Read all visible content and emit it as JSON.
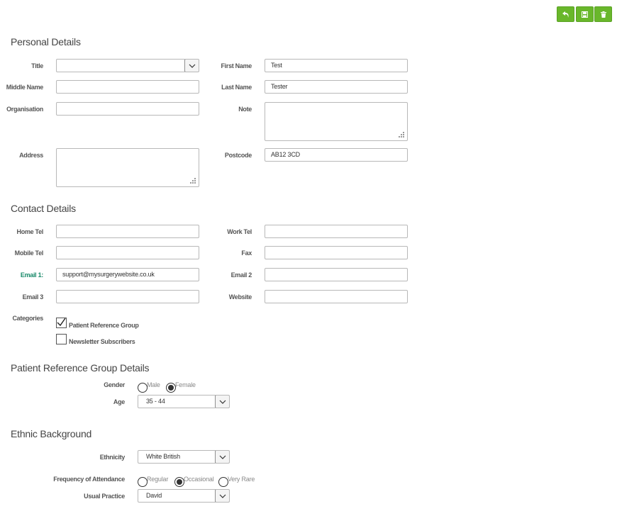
{
  "toolbar": {
    "back_icon": "undo-icon",
    "save_icon": "save-icon",
    "delete_icon": "trash-icon",
    "accent": "#69b72b"
  },
  "personal": {
    "title": "Personal Details",
    "title_label": "Title",
    "title_value": "",
    "first_name_label": "First Name",
    "first_name": "Test",
    "middle_name_label": "Middle Name",
    "middle_name": "",
    "last_name_label": "Last Name",
    "last_name": "Tester",
    "organisation_label": "Organisation",
    "organisation": "",
    "note_label": "Note",
    "note": "",
    "address_label": "Address",
    "address": "",
    "postcode_label": "Postcode",
    "postcode": "AB12 3CD"
  },
  "contact": {
    "title": "Contact Details",
    "home_tel_label": "Home Tel",
    "home_tel": "",
    "work_tel_label": "Work Tel",
    "work_tel": "",
    "mobile_tel_label": "Mobile Tel",
    "mobile_tel": "",
    "fax_label": "Fax",
    "fax": "",
    "email1_label": "Email 1:",
    "email1": "support@mysurgerywebsite.co.uk",
    "email2_label": "Email 2",
    "email2": "",
    "email3_label": "Email 3",
    "email3": "",
    "website_label": "Website",
    "website": "",
    "categories_label": "Categories",
    "categories": [
      {
        "label": "Patient Reference Group",
        "checked": true
      },
      {
        "label": "Newsletter Subscribers",
        "checked": false
      }
    ]
  },
  "prg": {
    "title": "Patient Reference Group Details",
    "gender_label": "Gender",
    "gender_options": [
      "Male",
      "Female"
    ],
    "gender_selected": "Female",
    "age_label": "Age",
    "age_value": "35 - 44"
  },
  "ethnic": {
    "title": "Ethnic Background",
    "ethnicity_label": "Ethnicity",
    "ethnicity_value": "White British",
    "frequency_label": "Frequency of Attendance",
    "frequency_options": [
      "Regular",
      "Occasional",
      "Very Rare"
    ],
    "frequency_selected": "Occasional",
    "practice_label": "Usual Practice",
    "practice_value": "David"
  }
}
